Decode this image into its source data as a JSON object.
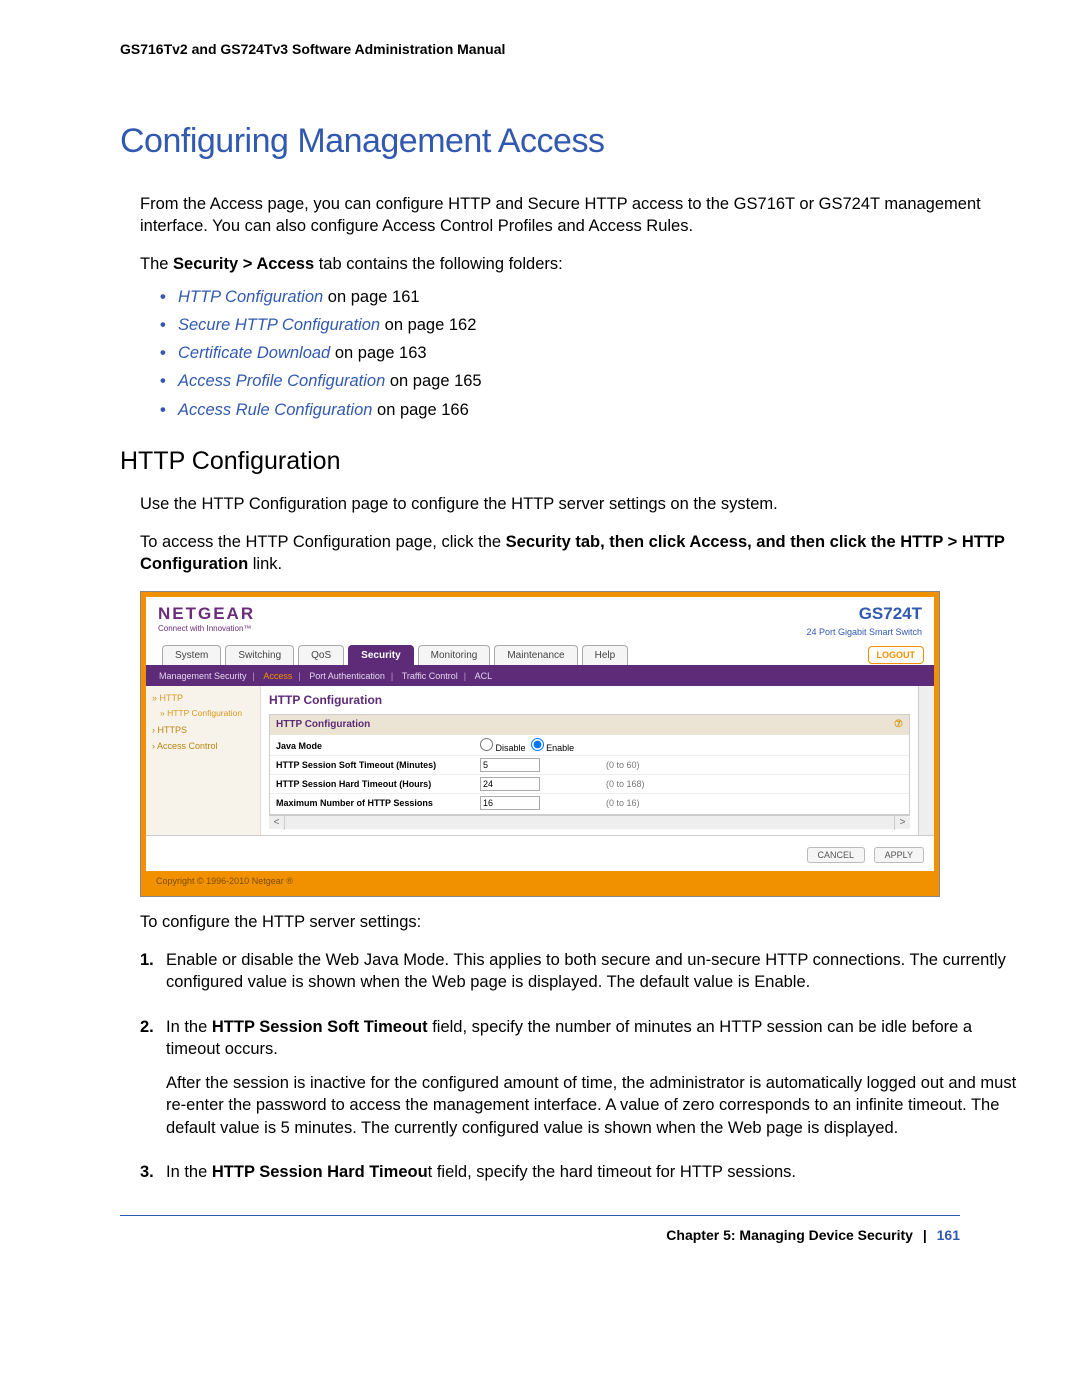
{
  "header": {
    "manual_title": "GS716Tv2 and GS724Tv3 Software Administration Manual"
  },
  "main": {
    "heading": "Configuring Management Access",
    "intro": "From the Access page, you can configure HTTP and Secure HTTP access to the GS716T or GS724T management interface. You can also configure Access Control Profiles and Access Rules.",
    "tab_sentence_prefix": "The ",
    "tab_sentence_bold": "Security > Access",
    "tab_sentence_suffix": " tab contains the following folders:",
    "bullets": [
      {
        "link": "HTTP Configuration",
        "suffix": " on page 161"
      },
      {
        "link": "Secure HTTP Configuration",
        "suffix": " on page 162"
      },
      {
        "link": "Certificate Download",
        "suffix": " on page 163"
      },
      {
        "link": "Access Profile Configuration",
        "suffix": " on page 165"
      },
      {
        "link": "Access Rule Configuration",
        "suffix": " on page 166"
      }
    ],
    "subheading": "HTTP Configuration",
    "sub_intro": "Use the HTTP Configuration page to configure the HTTP server settings on the system.",
    "access_prefix": "To access the HTTP Configuration page, click the ",
    "access_bold": "Security tab, then click Access, and then click the HTTP > HTTP Configuration",
    "access_suffix": " link.",
    "post_screenshot": "To configure the HTTP server settings:",
    "steps": [
      {
        "num": "1.",
        "paras": [
          "Enable or disable the Web Java Mode. This applies to both secure and un-secure HTTP connections. The currently configured value is shown when the Web page is displayed. The default value is Enable."
        ]
      },
      {
        "num": "2.",
        "bold_inline": "HTTP Session Soft Timeout",
        "line": "In the HTTP Session Soft Timeout field, specify the number of minutes an HTTP session can be idle before a timeout occurs.",
        "extra": "After the session is inactive for the configured amount of time, the administrator is automatically logged out and must re-enter the password to access the management interface. A value of zero corresponds to an infinite timeout. The default value is 5 minutes. The currently configured value is shown when the Web page is displayed."
      },
      {
        "num": "3.",
        "bold_inline": "HTTP Session Hard Timeou",
        "line": "In the HTTP Session Hard Timeout field, specify the hard timeout for HTTP sessions."
      }
    ]
  },
  "screenshot": {
    "brand": "NETGEAR",
    "brand_tag": "Connect with Innovation™",
    "model": "GS724T",
    "model_sub": "24 Port Gigabit Smart Switch",
    "tabs": [
      "System",
      "Switching",
      "QoS",
      "Security",
      "Monitoring",
      "Maintenance",
      "Help"
    ],
    "active_tab": "Security",
    "logout": "LOGOUT",
    "subnav": [
      "Management Security",
      "Access",
      "Port Authentication",
      "Traffic Control",
      "ACL"
    ],
    "subnav_active": "Access",
    "sidebar": [
      {
        "label": "HTTP",
        "cls": "sel"
      },
      {
        "label": "HTTP Configuration",
        "cls": "sub"
      },
      {
        "label": "HTTPS",
        "cls": ""
      },
      {
        "label": "Access Control",
        "cls": ""
      }
    ],
    "panel_title": "HTTP Configuration",
    "box_title": "HTTP Configuration",
    "rows": {
      "java_mode_label": "Java Mode",
      "java_disable": "Disable",
      "java_enable": "Enable",
      "soft_label": "HTTP Session Soft Timeout (Minutes)",
      "soft_value": "5",
      "soft_hint": "(0 to 60)",
      "hard_label": "HTTP Session Hard Timeout (Hours)",
      "hard_value": "24",
      "hard_hint": "(0 to 168)",
      "max_label": "Maximum Number of HTTP Sessions",
      "max_value": "16",
      "max_hint": "(0 to 16)"
    },
    "buttons": {
      "cancel": "CANCEL",
      "apply": "APPLY"
    },
    "copyright": "Copyright © 1996-2010 Netgear ®"
  },
  "footer": {
    "chapter": "Chapter 5:  Managing Device Security",
    "page": "161"
  }
}
